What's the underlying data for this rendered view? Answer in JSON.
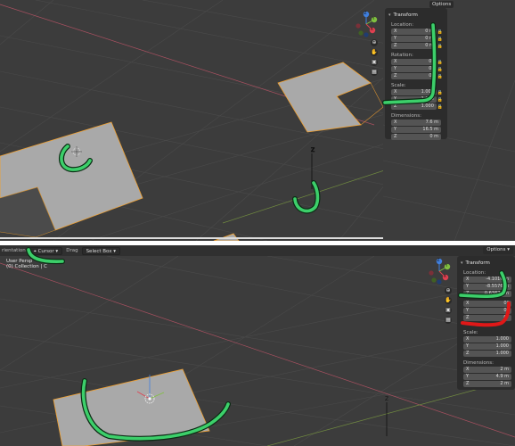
{
  "top_view": {
    "options_label": "Options",
    "gizmo_axes": [
      "Z",
      "Y",
      "X"
    ],
    "panel": {
      "title": "Transform",
      "location_label": "Location:",
      "location": [
        {
          "axis": "X",
          "value": "0 m"
        },
        {
          "axis": "Y",
          "value": "0 m"
        },
        {
          "axis": "Z",
          "value": "0 m"
        }
      ],
      "rotation_label": "Rotation:",
      "rotation": [
        {
          "axis": "X",
          "value": "0°"
        },
        {
          "axis": "Y",
          "value": "0°"
        },
        {
          "axis": "Z",
          "value": "0°"
        }
      ],
      "scale_label": "Scale:",
      "scale": [
        {
          "axis": "X",
          "value": "1.000"
        },
        {
          "axis": "Y",
          "value": "1.000"
        },
        {
          "axis": "Z",
          "value": "1.000"
        }
      ],
      "dimensions_label": "Dimensions:",
      "dimensions": [
        {
          "axis": "X",
          "value": "7.6 m"
        },
        {
          "axis": "Y",
          "value": "16.5 m"
        },
        {
          "axis": "Z",
          "value": "0 m"
        }
      ]
    }
  },
  "bottom_view": {
    "header": {
      "orientation_partial": "rientation",
      "tool_label": "Cursor",
      "drag_label": "Drag",
      "select_label": "Select Box",
      "options_label": "Options"
    },
    "viewport_title": "User Persp",
    "collection_label": "(0) Collection | C",
    "gizmo_axes": [
      "Z",
      "Y",
      "X"
    ],
    "panel": {
      "title": "Transform",
      "location_label": "Location:",
      "location": [
        {
          "axis": "X",
          "value": "-4.1016 m"
        },
        {
          "axis": "Y",
          "value": "-8.5576 m"
        },
        {
          "axis": "Z",
          "value": "0.63874 m"
        }
      ],
      "rotation": [
        {
          "axis": "X",
          "value": "0°"
        },
        {
          "axis": "Y",
          "value": "0°"
        },
        {
          "axis": "Z",
          "value": "0°"
        }
      ],
      "scale_label": "Scale:",
      "scale": [
        {
          "axis": "X",
          "value": "1.000"
        },
        {
          "axis": "Y",
          "value": "1.000"
        },
        {
          "axis": "Z",
          "value": "1.000"
        }
      ],
      "dimensions_label": "Dimensions:",
      "dimensions": [
        {
          "axis": "X",
          "value": "2 m"
        },
        {
          "axis": "Y",
          "value": "4.9 m"
        },
        {
          "axis": "Z",
          "value": "2 m"
        }
      ]
    }
  },
  "colors": {
    "viewport_bg": "#3c3c3c",
    "grid": "#4a4a4a",
    "mesh_face": "#a9a9a9",
    "mesh_edge": "#f0a030",
    "annotation_green": "#3ccf6a",
    "annotation_red": "#e01818",
    "axis_x": "#e04050",
    "axis_y": "#80c040",
    "axis_z": "#4080e0"
  },
  "icons": [
    "zoom-icon",
    "pan-hand-icon",
    "camera-icon",
    "grid-icon",
    "lock-icon",
    "cursor-icon"
  ]
}
